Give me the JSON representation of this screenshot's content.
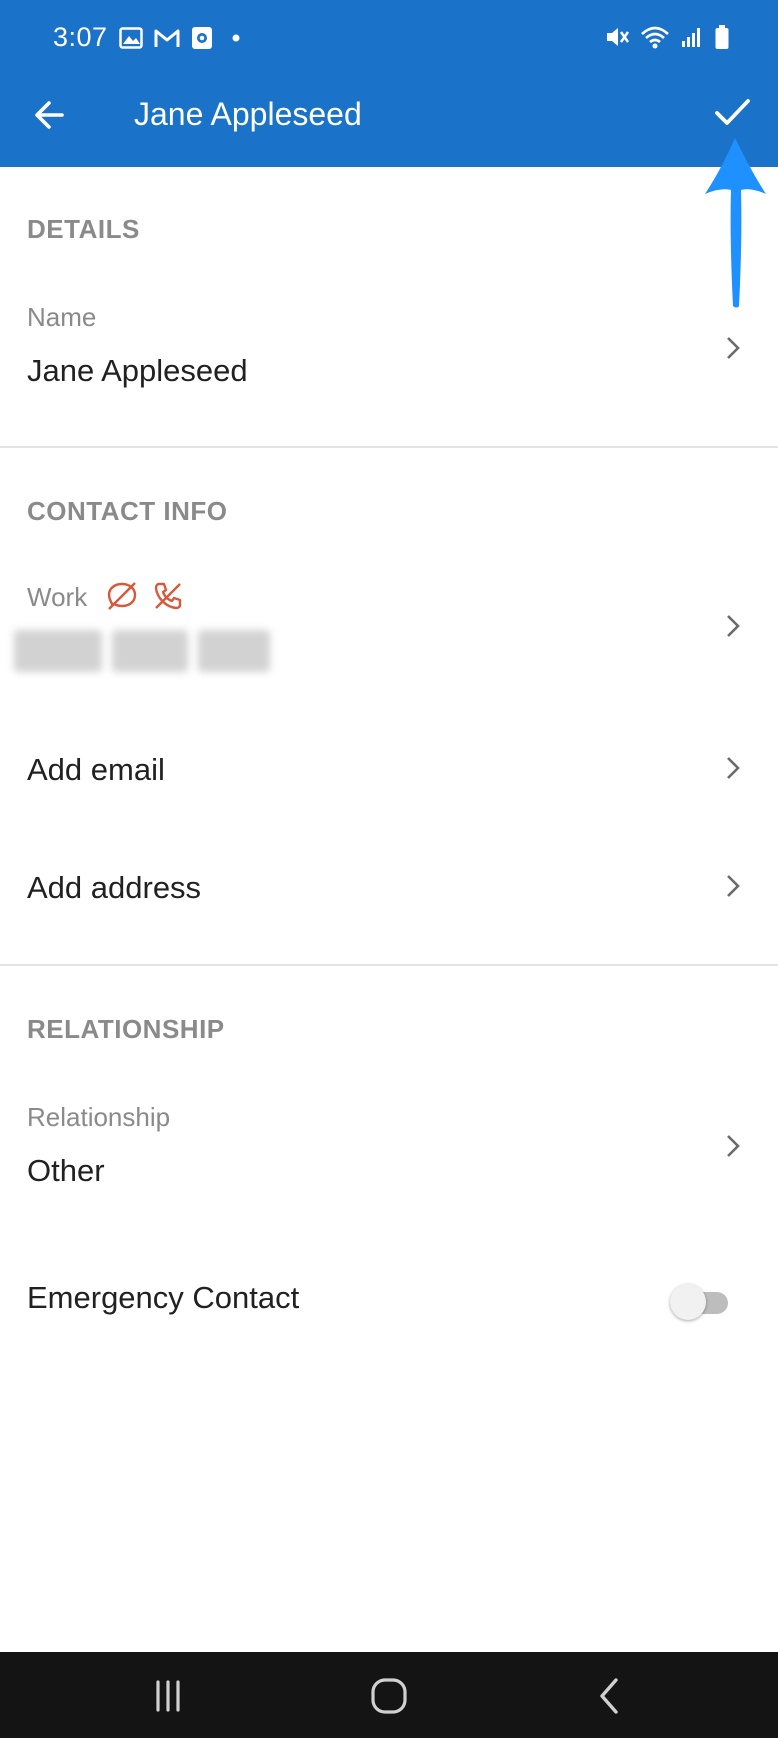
{
  "status_bar": {
    "time": "3:07",
    "left_icons": [
      "image-icon",
      "gmail-icon",
      "outlook-icon",
      "dot-icon"
    ],
    "right_icons": [
      "mute-icon",
      "wifi-icon",
      "signal-icon",
      "battery-icon"
    ]
  },
  "toolbar": {
    "title": "Jane Appleseed",
    "back_icon": "arrow-left-icon",
    "save_icon": "check-icon"
  },
  "annotation": {
    "color": "#1e90ff"
  },
  "details": {
    "header": "DETAILS",
    "name_label": "Name",
    "name_value": "Jane Appleseed"
  },
  "contact_info": {
    "header": "CONTACT INFO",
    "work_label": "Work",
    "work_icons": [
      "no-sms-icon",
      "no-call-icon"
    ],
    "add_email": "Add email",
    "add_address": "Add address"
  },
  "relationship": {
    "header": "RELATIONSHIP",
    "label": "Relationship",
    "value": "Other",
    "emergency_label": "Emergency Contact",
    "emergency_on": false
  },
  "colors": {
    "appbar": "#1a73c8",
    "accent_red": "#d9583b",
    "section_gray": "#8a8a8a"
  },
  "nav_bar": {
    "buttons": [
      "recents-icon",
      "home-icon",
      "back-icon"
    ]
  }
}
